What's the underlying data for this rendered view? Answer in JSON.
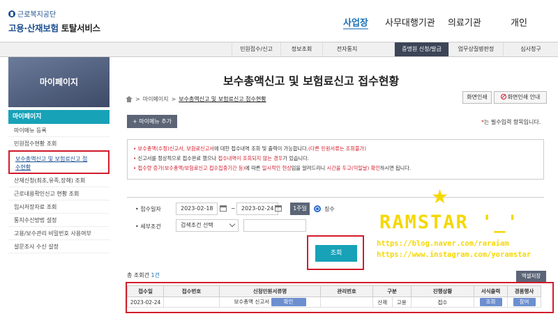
{
  "header": {
    "org_name": "근로복지공단",
    "service_name_blue": "고용·산재보험",
    "service_name_dark": "토탈서비스",
    "top_nav": [
      "사업장",
      "사무대행기관",
      "의료기관",
      "개인"
    ],
    "active_top": "사업장"
  },
  "menu": {
    "items": [
      "민원접수/신고",
      "정보조회",
      "전자통지",
      "증명원 신청/발급",
      "업무상질병판정",
      "심사청구"
    ],
    "active": "증명원 신청/발급"
  },
  "sidebar": {
    "banner": "마이페이지",
    "heading": "마이페이지",
    "items": [
      "마이메뉴 등록",
      "민원접수현황 조회",
      "보수총액신고 및 보험료신고 접수현황",
      "산재신청(최초,유족,장해) 조회",
      "근로내용확인신고 현황 조회",
      "임시저장자료 조회",
      "통지수신방법 설정",
      "고용/보수관리 비밀번호 사용여부",
      "설문조사 수신 설정"
    ]
  },
  "page": {
    "title": "보수총액신고 및 보험료신고 접수현황",
    "breadcrumb": [
      "마이페이지",
      "보수총액신고 및 보험료신고 접수현황"
    ],
    "print_button": "화면인쇄",
    "print_guide_button": "화면인쇄 안내",
    "add_mymenu_button": "+ 마이메뉴 추가",
    "required_note_star": "*",
    "required_note": "는 필수입력 항목입니다."
  },
  "notice": {
    "lines": [
      {
        "pre": "보수총액(수정)신고서, 보험료신고서",
        "mid": "에 대한 접수내역 조회 및 출력이 가능합니다.",
        "post": "(다른 민원서류는 조회불가)"
      },
      {
        "pre": "신고서를 정상적으로 접수완료 했으나 ",
        "red": "접수내역이 조회되지 않는 경우",
        "post": "가 있습니다."
      },
      {
        "pre": "접수량 증가(보수총액/보험료신고 접수집중기간 등)",
        "mid": "에 따른 ",
        "red": "일시적인 현상",
        "mid2": "임을 알려드리니 ",
        "red2": "시간을 두고(익일날) 확인",
        "post": "하시면 됩니다."
      }
    ]
  },
  "search": {
    "date_label": "접수일자",
    "date_from": "2023-02-18",
    "date_to": "2023-02-24",
    "week_button": "1주일",
    "radio_label": "징수",
    "cond_label": "세부조건",
    "cond_select": "검색조건 선택",
    "cond_input": "",
    "query_button": "조회"
  },
  "results": {
    "total_label": "총 조회건",
    "total_count": "1건",
    "excel_button": "엑셀저장",
    "columns": [
      "접수일",
      "접수번호",
      "신청민원서류명",
      "관리번호",
      "구분",
      "진행상황",
      "서식출력",
      "경품행사"
    ],
    "rows": [
      {
        "date": "2023-02-24",
        "receipt_no": "",
        "doc_name": "보수총액 신고서",
        "doc_button": "확인",
        "mgmt_no": "",
        "type1": "산재",
        "type2": "고용",
        "status": "접수",
        "print_button": "조회",
        "event_button": "참여"
      }
    ]
  },
  "watermark": {
    "star": "★",
    "title": "RAMSTAR '_'",
    "line1": "https://blog.naver.com/raraiam",
    "line2": "https://www.instagram.com/yoramstar"
  },
  "colors": {
    "brand": "#1a4d8f",
    "accent": "#17a2b8",
    "highlight": "#d21c2c",
    "watermark": "#f5d800"
  }
}
